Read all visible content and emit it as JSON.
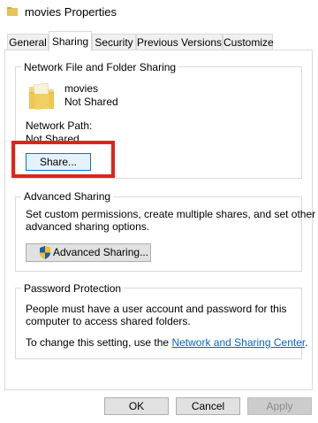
{
  "window": {
    "title": "movies Properties"
  },
  "tabs": [
    {
      "label": "General"
    },
    {
      "label": "Sharing"
    },
    {
      "label": "Security"
    },
    {
      "label": "Previous Versions"
    },
    {
      "label": "Customize"
    }
  ],
  "network_sharing": {
    "group_title": "Network File and Folder Sharing",
    "folder_name": "movies",
    "folder_status": "Not Shared",
    "path_label": "Network Path:",
    "path_value": "Not Shared",
    "share_button": "Share..."
  },
  "advanced_sharing": {
    "group_title": "Advanced Sharing",
    "description_line1": "Set custom permissions, create multiple shares, and set other",
    "description_line2": "advanced sharing options.",
    "button": "Advanced Sharing..."
  },
  "password_protection": {
    "group_title": "Password Protection",
    "line1": "People must have a user account and password for this",
    "line2": "computer to access shared folders.",
    "change_prefix": "To change this setting, use the ",
    "link": "Network and Sharing Center",
    "change_suffix": "."
  },
  "footer": {
    "ok": "OK",
    "cancel": "Cancel",
    "apply": "Apply"
  },
  "colors": {
    "highlight": "#e0231b",
    "link": "#0066cc",
    "focus": "#0078d7"
  }
}
